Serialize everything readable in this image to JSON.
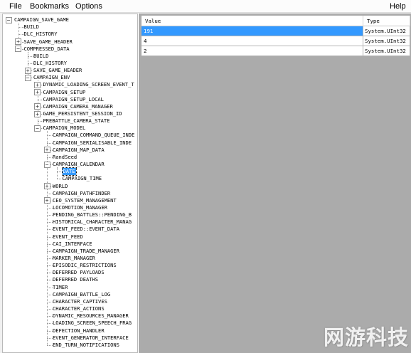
{
  "menu": {
    "file": "File",
    "bookmarks": "Bookmarks",
    "options": "Options",
    "help": "Help"
  },
  "tree": [
    {
      "label": "CAMPAIGN_SAVE_GAME",
      "level": 0,
      "expander": "-"
    },
    {
      "label": "BUILD",
      "level": 1,
      "expander": ""
    },
    {
      "label": "DLC_HISTORY",
      "level": 1,
      "expander": ""
    },
    {
      "label": "SAVE_GAME_HEADER",
      "level": 1,
      "expander": "+"
    },
    {
      "label": "COMPRESSED_DATA",
      "level": 1,
      "expander": "-"
    },
    {
      "label": "BUILD",
      "level": 2,
      "expander": ""
    },
    {
      "label": "DLC_HISTORY",
      "level": 2,
      "expander": ""
    },
    {
      "label": "SAVE_GAME_HEADER",
      "level": 2,
      "expander": "+"
    },
    {
      "label": "CAMPAIGN_ENV",
      "level": 2,
      "expander": "-"
    },
    {
      "label": "DYNAMIC_LOADING_SCREEN_EVENT_T",
      "level": 3,
      "expander": "+"
    },
    {
      "label": "CAMPAIGN_SETUP",
      "level": 3,
      "expander": "+"
    },
    {
      "label": "CAMPAIGN_SETUP_LOCAL",
      "level": 3,
      "expander": ""
    },
    {
      "label": "CAMPAIGN_CAMERA_MANAGER",
      "level": 3,
      "expander": "+"
    },
    {
      "label": "GAME_PERSISTENT_SESSION_ID",
      "level": 3,
      "expander": "+"
    },
    {
      "label": "PREBATTLE_CAMERA_STATE",
      "level": 3,
      "expander": ""
    },
    {
      "label": "CAMPAIGN_MODEL",
      "level": 3,
      "expander": "-"
    },
    {
      "label": "CAMPAIGN_COMMAND_QUEUE_INDE",
      "level": 4,
      "expander": ""
    },
    {
      "label": "CAMPAIGN_SERIALISABLE_INDE",
      "level": 4,
      "expander": ""
    },
    {
      "label": "CAMPAIGN_MAP_DATA",
      "level": 4,
      "expander": "+"
    },
    {
      "label": "RandSeed",
      "level": 4,
      "expander": ""
    },
    {
      "label": "CAMPAIGN_CALENDAR",
      "level": 4,
      "expander": "-"
    },
    {
      "label": "DATE",
      "level": 5,
      "expander": "",
      "selected": true
    },
    {
      "label": "CAMPAIGN_TIME",
      "level": 5,
      "expander": ""
    },
    {
      "label": "WORLD",
      "level": 4,
      "expander": "+"
    },
    {
      "label": "CAMPAIGN_PATHFINDER",
      "level": 4,
      "expander": ""
    },
    {
      "label": "CEO_SYSTEM_MANAGEMENT",
      "level": 4,
      "expander": "+"
    },
    {
      "label": "LOCOMOTION_MANAGER",
      "level": 4,
      "expander": ""
    },
    {
      "label": "PENDING_BATTLES::PENDING_B",
      "level": 4,
      "expander": ""
    },
    {
      "label": "HISTORICAL_CHARACTER_MANAG",
      "level": 4,
      "expander": ""
    },
    {
      "label": "EVENT_FEED::EVENT_DATA",
      "level": 4,
      "expander": ""
    },
    {
      "label": "EVENT_FEED",
      "level": 4,
      "expander": ""
    },
    {
      "label": "CAI_INTERFACE",
      "level": 4,
      "expander": ""
    },
    {
      "label": "CAMPAIGN_TRADE_MANAGER",
      "level": 4,
      "expander": ""
    },
    {
      "label": "MARKER_MANAGER",
      "level": 4,
      "expander": ""
    },
    {
      "label": "EPISODIC_RESTRICTIONS",
      "level": 4,
      "expander": ""
    },
    {
      "label": "DEFERRED PAYLOADS",
      "level": 4,
      "expander": ""
    },
    {
      "label": "DEFERRED DEATHS",
      "level": 4,
      "expander": ""
    },
    {
      "label": "TIMER",
      "level": 4,
      "expander": ""
    },
    {
      "label": "CAMPAIGN_BATTLE_LOG",
      "level": 4,
      "expander": ""
    },
    {
      "label": "CHARACTER_CAPTIVES",
      "level": 4,
      "expander": ""
    },
    {
      "label": "CHARACTER_ACTIONS",
      "level": 4,
      "expander": ""
    },
    {
      "label": "DYNAMIC_RESOURCES_MANAGER",
      "level": 4,
      "expander": ""
    },
    {
      "label": "LOADING_SCREEN_SPEECH_FRAG",
      "level": 4,
      "expander": ""
    },
    {
      "label": "DEFECTION_HANDLER",
      "level": 4,
      "expander": ""
    },
    {
      "label": "EVENT_GENERATOR_INTERFACE",
      "level": 4,
      "expander": ""
    },
    {
      "label": "END_TURN_NOTIFICATIONS",
      "level": 4,
      "expander": ""
    }
  ],
  "grid": {
    "headers": {
      "value": "Value",
      "type": "Type"
    },
    "rows": [
      {
        "value": "191",
        "type": "System.UInt32",
        "selected": true
      },
      {
        "value": "4",
        "type": "System.UInt32",
        "selected": false
      },
      {
        "value": "2",
        "type": "System.UInt32",
        "selected": false
      }
    ]
  },
  "watermark": "网游科技"
}
